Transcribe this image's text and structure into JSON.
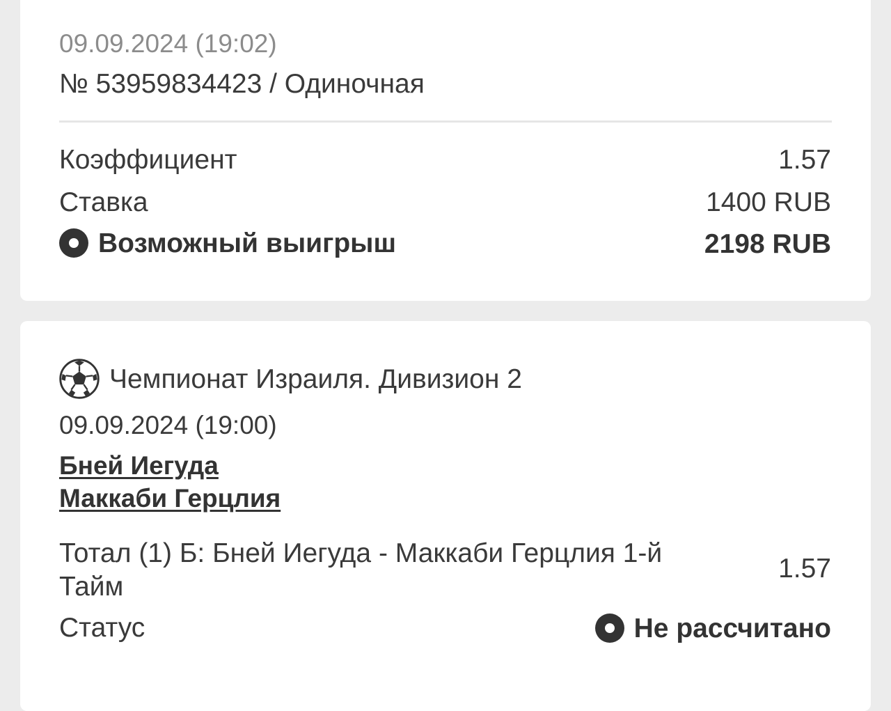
{
  "bet": {
    "placed_at": "09.09.2024 (19:02)",
    "title": "№ 53959834423 / Одиночная",
    "coefficient_label": "Коэффициент",
    "coefficient_value": "1.57",
    "stake_label": "Ставка",
    "stake_value": "1400 RUB",
    "win_label": "Возможный выигрыш",
    "win_value": "2198 RUB"
  },
  "event": {
    "league": "Чемпионат Израиля. Дивизион 2",
    "date": "09.09.2024 (19:00)",
    "team_home": "Бней Иегуда",
    "team_away": "Маккаби Герцлия",
    "market": "Тотал (1) Б: Бней Иегуда - Маккаби Герцлия 1-й Тайм",
    "market_coefficient": "1.57",
    "status_label": "Статус",
    "status_value": "Не рассчитано"
  },
  "icons": {
    "win": "radio-dot-icon",
    "league": "soccer-ball-icon",
    "status": "radio-dot-icon"
  },
  "colors": {
    "background": "#ececec",
    "card": "#ffffff",
    "text": "#3a3a3a",
    "muted_text": "#8c8c8c",
    "divider": "#e6e6e6"
  }
}
